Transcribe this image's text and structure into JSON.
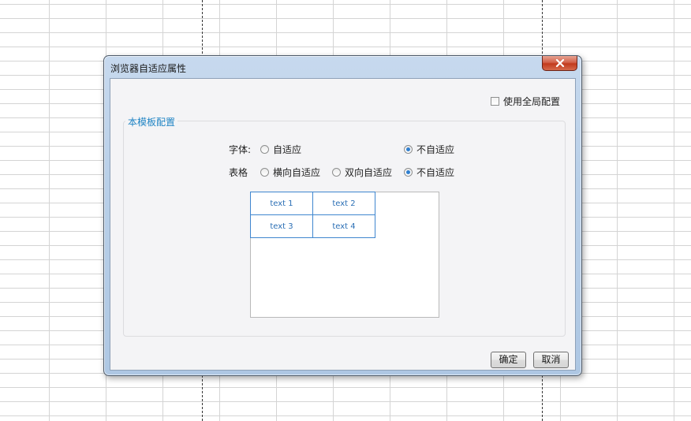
{
  "dialog": {
    "title": "浏览器自适应属性",
    "close_label": "x"
  },
  "global_config": {
    "label": "使用全局配置",
    "checked": false
  },
  "group": {
    "title": "本模板配置",
    "font": {
      "label": "字体:",
      "options": [
        "自适应",
        "不自适应"
      ],
      "selected": "不自适应"
    },
    "table": {
      "label": "表格",
      "options": [
        "横向自适应",
        "双向自适应",
        "不自适应"
      ],
      "selected": "不自适应"
    },
    "preview": {
      "cells": [
        [
          "text 1",
          "text 2"
        ],
        [
          "text 3",
          "text 4"
        ]
      ]
    }
  },
  "buttons": {
    "ok": "确定",
    "cancel": "取消"
  },
  "colors": {
    "accent": "#1f84c4",
    "radio_dot": "#2f7fd0",
    "preview_border": "#3f86cf"
  }
}
